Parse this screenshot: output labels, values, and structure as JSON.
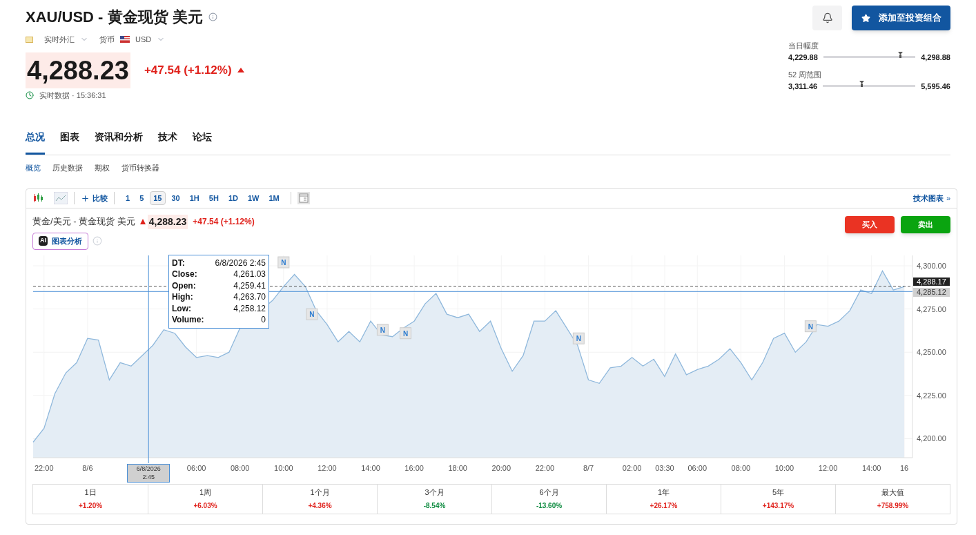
{
  "header": {
    "title": "XAU/USD - 黄金现货 美元",
    "market": "实时外汇",
    "currency_label": "货币",
    "currency": "USD",
    "price": "4,288.23",
    "change": "+47.54",
    "change_pct": "(+1.12%)",
    "color": "#e0211b",
    "status": "实时数据 · 15:36:31"
  },
  "actions": {
    "portfolio_button": "添加至投资组合"
  },
  "ranges": [
    {
      "label": "当日幅度",
      "low": "4,229.88",
      "high": "4,298.88",
      "level": 0.84
    },
    {
      "label": "52 周范围",
      "low": "3,311.46",
      "high": "5,595.46",
      "level": 0.42
    }
  ],
  "tabs": [
    {
      "label": "总况",
      "selected": true
    },
    {
      "label": "图表",
      "selected": false
    },
    {
      "label": "资讯和分析",
      "selected": false
    },
    {
      "label": "技术",
      "selected": false
    },
    {
      "label": "论坛",
      "selected": false
    }
  ],
  "subtabs": [
    {
      "label": "概览",
      "selected": true
    },
    {
      "label": "历史数据",
      "selected": false
    },
    {
      "label": "期权",
      "selected": false
    },
    {
      "label": "货币转换器",
      "selected": false
    }
  ],
  "chart_panel": {
    "compare": "比较",
    "intervals": [
      {
        "label": "1",
        "selected": false
      },
      {
        "label": "5",
        "selected": false
      },
      {
        "label": "15",
        "selected": true
      },
      {
        "label": "30",
        "selected": false
      },
      {
        "label": "1H",
        "selected": false
      },
      {
        "label": "5H",
        "selected": false
      },
      {
        "label": "1D",
        "selected": false
      },
      {
        "label": "1W",
        "selected": false
      },
      {
        "label": "1M",
        "selected": false
      }
    ],
    "tech_link": "技术图表",
    "tech_link_icon": "»",
    "instrument": "黄金/美元 - 黄金现货 美元",
    "price": "4,288.23",
    "change": "+47.54",
    "change_pct": "(+1.12%)",
    "color": "#e0211b",
    "buy": "买入",
    "sell": "卖出",
    "ai_button": "图表分析",
    "ai_badge": "AI",
    "tooltip": [
      {
        "label": "DT:",
        "value": "6/8/2026 2:45"
      },
      {
        "label": "Close:",
        "value": "4,261.03"
      },
      {
        "label": "Open:",
        "value": "4,259.41"
      },
      {
        "label": "High:",
        "value": "4,263.70"
      },
      {
        "label": "Low:",
        "value": "4,258.12"
      },
      {
        "label": "Volume:",
        "value": "0"
      }
    ],
    "crosshair": {
      "date": "6/8/2026",
      "time": "2:45",
      "price": "4,285.12"
    },
    "last_price_tag": {
      "text": "4,288.17"
    },
    "news_markers": [
      {
        "label": "N"
      },
      {
        "label": "N"
      },
      {
        "label": "N"
      },
      {
        "label": "N"
      },
      {
        "label": "N"
      },
      {
        "label": "N"
      }
    ],
    "chart_data": {
      "type": "area",
      "grid": true,
      "ylim": [
        4189,
        4306
      ],
      "ref_lines": [
        {
          "axis": "y",
          "value": 4288.17
        },
        {
          "axis": "y",
          "value": 4285.12
        }
      ],
      "yticks": [
        {
          "value": 4200,
          "label": "4,200.00"
        },
        {
          "value": 4225,
          "label": "4,225.00"
        },
        {
          "value": 4250,
          "label": "4,250.00"
        },
        {
          "value": 4275,
          "label": "4,275.00"
        },
        {
          "value": 4300,
          "label": "4,300.00"
        }
      ],
      "categories": [
        null,
        "22:00",
        null,
        null,
        null,
        "8/6",
        null,
        null,
        null,
        null,
        null,
        null,
        null,
        null,
        null,
        "06:00",
        null,
        null,
        null,
        "08:00",
        null,
        null,
        null,
        "10:00",
        null,
        null,
        null,
        "12:00",
        null,
        null,
        null,
        "14:00",
        null,
        null,
        null,
        "16:00",
        null,
        null,
        null,
        "18:00",
        null,
        null,
        null,
        "20:00",
        null,
        null,
        null,
        "22:00",
        null,
        null,
        null,
        "8/7",
        null,
        null,
        null,
        "02:00",
        null,
        null,
        "03:30",
        null,
        null,
        "06:00",
        null,
        null,
        null,
        "08:00",
        null,
        null,
        null,
        "10:00",
        null,
        null,
        null,
        "12:00",
        null,
        null,
        null,
        "14:00",
        null,
        null,
        "16"
      ],
      "series": [
        {
          "color": "#8fb8dc",
          "values": [
            4198,
            4206,
            4226,
            4238,
            4244,
            4258,
            4257,
            4234,
            4244,
            4242,
            4248,
            4254,
            4263,
            4261,
            4253,
            4247,
            4248,
            4247,
            4250,
            4264,
            null,
            null,
            4280,
            4288,
            4295,
            4288,
            4274,
            4266,
            4256,
            4262,
            4256,
            4268,
            4260,
            4259,
            4264,
            4268,
            4278,
            4284,
            4272,
            4270,
            4272,
            4262,
            4268,
            4252,
            4239,
            4248,
            4268,
            4268,
            4274,
            4264,
            4254,
            4234,
            4232,
            4241,
            4242,
            4247,
            4242,
            4246,
            4236,
            4249,
            4237,
            4240,
            4242,
            4246,
            4252,
            4244,
            4234,
            4244,
            4258,
            4261,
            4250,
            4256,
            4266,
            4265,
            4268,
            4274,
            4286,
            4284,
            4297,
            4286,
            4288
          ]
        }
      ]
    },
    "performance": [
      {
        "period": "1日",
        "change": "+1.20%",
        "color": "#e0211b"
      },
      {
        "period": "1周",
        "change": "+6.03%",
        "color": "#e0211b"
      },
      {
        "period": "1个月",
        "change": "+4.36%",
        "color": "#e0211b"
      },
      {
        "period": "3个月",
        "change": "-8.54%",
        "color": "#0b8a3e"
      },
      {
        "period": "6个月",
        "change": "-13.60%",
        "color": "#0b8a3e"
      },
      {
        "period": "1年",
        "change": "+26.17%",
        "color": "#e0211b"
      },
      {
        "period": "5年",
        "change": "+143.17%",
        "color": "#e0211b"
      },
      {
        "period": "最大值",
        "change": "+758.99%",
        "color": "#e0211b"
      }
    ]
  }
}
